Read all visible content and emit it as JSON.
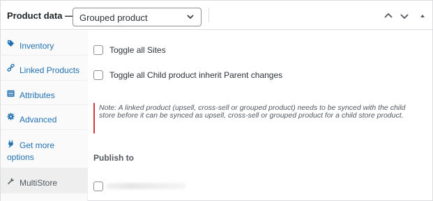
{
  "header": {
    "title": "Product data —",
    "product_type": "Grouped product",
    "icons": {
      "select": "chevron-down-icon",
      "up": "chevron-up-icon",
      "down": "chevron-down-icon",
      "toggle": "triangle-up-icon"
    }
  },
  "sidebar": {
    "tabs": [
      {
        "label": "Inventory",
        "icon": "tag-icon",
        "active": false
      },
      {
        "label": "Linked Products",
        "icon": "link-icon",
        "active": false
      },
      {
        "label": "Attributes",
        "icon": "list-icon",
        "active": false
      },
      {
        "label": "Advanced",
        "icon": "gear-icon",
        "active": false
      },
      {
        "label": "Get more options",
        "icon": "plug-icon",
        "active": false
      },
      {
        "label": "MultiStore",
        "icon": "wrench-icon",
        "active": true
      }
    ]
  },
  "main": {
    "toggle_all_sites": {
      "label": "Toggle all Sites",
      "checked": false
    },
    "toggle_all_child": {
      "label": "Toggle all Child product inherit Parent changes",
      "checked": false
    },
    "note": "Note: A linked product (upsell, cross-sell or grouped product) needs to be synced with the child store before it can be synced as upsell, cross-sell or grouped product for a child store product.",
    "publish_to_title": "Publish to",
    "publish_site": {
      "checked": false
    }
  },
  "colors": {
    "link": "#2271b1",
    "note_border": "#d63638",
    "border": "#dcdcde",
    "active_tab_bg": "#eeeeee"
  }
}
